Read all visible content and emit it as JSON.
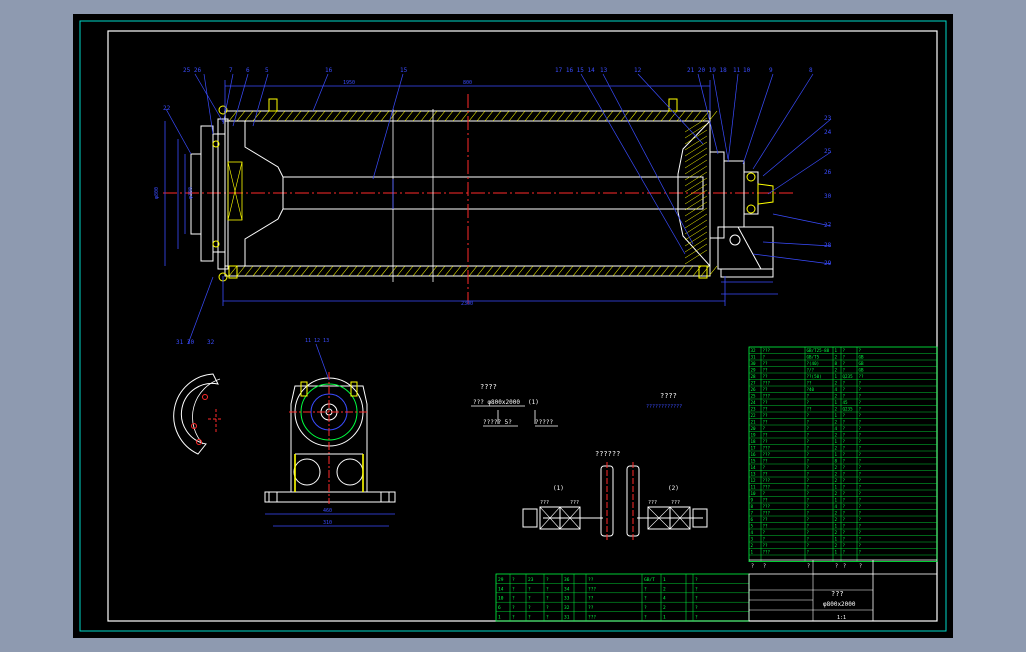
{
  "drawing": {
    "title_chars": "???",
    "model": "φ800x2000",
    "scale": "1:1",
    "spec_label": "??? φ800x2000",
    "spec_note_1": "(1)",
    "spec_note_2": "????? 5?",
    "spec_heading": "????",
    "tech_req": "????",
    "tech_req_sub": "????????????",
    "detail_heading": "??????",
    "detail_left_label": "(1)",
    "detail_right_label": "(2)",
    "detail_left_a": "???",
    "detail_left_b": "???",
    "detail_right_a": "???",
    "detail_right_b": "???"
  },
  "balloons": {
    "top": [
      "25 26",
      "7",
      "6",
      "5",
      "16",
      "15",
      "21 20 19 18",
      "22",
      "17 16 15 14",
      "13",
      "12",
      "11",
      "10",
      "9",
      "8"
    ],
    "bottom_left": [
      "31 30",
      "32"
    ],
    "bearing_view": [
      "11 12 13"
    ],
    "right": [
      "23",
      "24",
      "25",
      "26",
      "27",
      "28",
      "29",
      "30"
    ]
  },
  "colors": {
    "outline": "#ffffff",
    "dimension": "#3a4cff",
    "centerline": "#ff2a2a",
    "hatch": "#ffff00",
    "bom": "#00ff40",
    "frame": "#00d8c8",
    "detail": "#ff2a2a"
  },
  "bom_right": {
    "rows": [
      [
        "32",
        "???",
        "GB/T25-88",
        "1",
        "?",
        "?"
      ],
      [
        "31",
        "?",
        "GB/T5",
        "2",
        "?",
        "GB"
      ],
      [
        "30",
        "??",
        "?(40)",
        "8",
        "?",
        "GB"
      ],
      [
        "29",
        "??",
        "?/?",
        "2",
        "?",
        "GB"
      ],
      [
        "28",
        "??",
        "??(50)",
        "1",
        "Q235",
        "??"
      ],
      [
        "27",
        "???",
        "??",
        "2",
        "?",
        "?"
      ],
      [
        "26",
        "??",
        "?40",
        "4",
        "?",
        "?"
      ],
      [
        "25",
        "???",
        "?",
        "2",
        "?",
        "?"
      ],
      [
        "24",
        "??",
        "?",
        "1",
        "45",
        "?"
      ],
      [
        "23",
        "??",
        "??",
        "2",
        "Q235",
        "?"
      ],
      [
        "22",
        "??",
        "?",
        "1",
        "?",
        "?"
      ],
      [
        "21",
        "??",
        "?",
        "2",
        "?",
        "?"
      ],
      [
        "20",
        "?",
        "?",
        "4",
        "?",
        "?"
      ],
      [
        "19",
        "??",
        "?",
        "2",
        "?",
        "?"
      ],
      [
        "18",
        "??",
        "?",
        "1",
        "?",
        "?"
      ],
      [
        "17",
        "???",
        "?",
        "2",
        "?",
        "?"
      ],
      [
        "16",
        "???",
        "?",
        "1",
        "?",
        "?"
      ],
      [
        "15",
        "??",
        "?",
        "8",
        "?",
        "?"
      ],
      [
        "14",
        "?",
        "?",
        "2",
        "?",
        "?"
      ],
      [
        "13",
        "??",
        "?",
        "2",
        "?",
        "?"
      ],
      [
        "12",
        "???",
        "?",
        "2",
        "?",
        "?"
      ],
      [
        "11",
        "???",
        "?",
        "1",
        "?",
        "?"
      ],
      [
        "10",
        "?",
        "?",
        "2",
        "?",
        "?"
      ],
      [
        "9",
        "??",
        "?",
        "1",
        "?",
        "?"
      ],
      [
        "8",
        "???",
        "?",
        "4",
        "?",
        "?"
      ],
      [
        "7",
        "???",
        "?",
        "2",
        "?",
        "?"
      ],
      [
        "6",
        "??",
        "?",
        "2",
        "?",
        "?"
      ],
      [
        "5",
        "??",
        "?",
        "1",
        "?",
        "?"
      ],
      [
        "4",
        "?",
        "?",
        "2",
        "?",
        "?"
      ],
      [
        "3",
        "?",
        "?",
        "1",
        "?",
        "?"
      ],
      [
        "2",
        "??",
        "?",
        "2",
        "?",
        "?"
      ],
      [
        "1",
        "???",
        "?",
        "1",
        "?",
        "?"
      ]
    ],
    "header": [
      "?",
      "?",
      "?",
      "?",
      "?",
      "?"
    ]
  },
  "bom_left": {
    "rows": [
      [
        "29",
        "?",
        "23",
        "?",
        "36"
      ],
      [
        "14",
        "?",
        "?",
        "?",
        "34"
      ],
      [
        "10",
        "?",
        "?",
        "?",
        "33"
      ],
      [
        "6",
        "?",
        "?",
        "?",
        "32"
      ],
      [
        "1",
        "?",
        "?",
        "?",
        "31"
      ]
    ],
    "items": [
      [
        "??",
        "GB/T",
        "1",
        "?"
      ],
      [
        "???",
        "?",
        "2",
        "?"
      ],
      [
        "??",
        "?",
        "4",
        "?"
      ],
      [
        "??",
        "?",
        "2",
        "?"
      ],
      [
        "???",
        "?",
        "1",
        "?"
      ]
    ]
  }
}
